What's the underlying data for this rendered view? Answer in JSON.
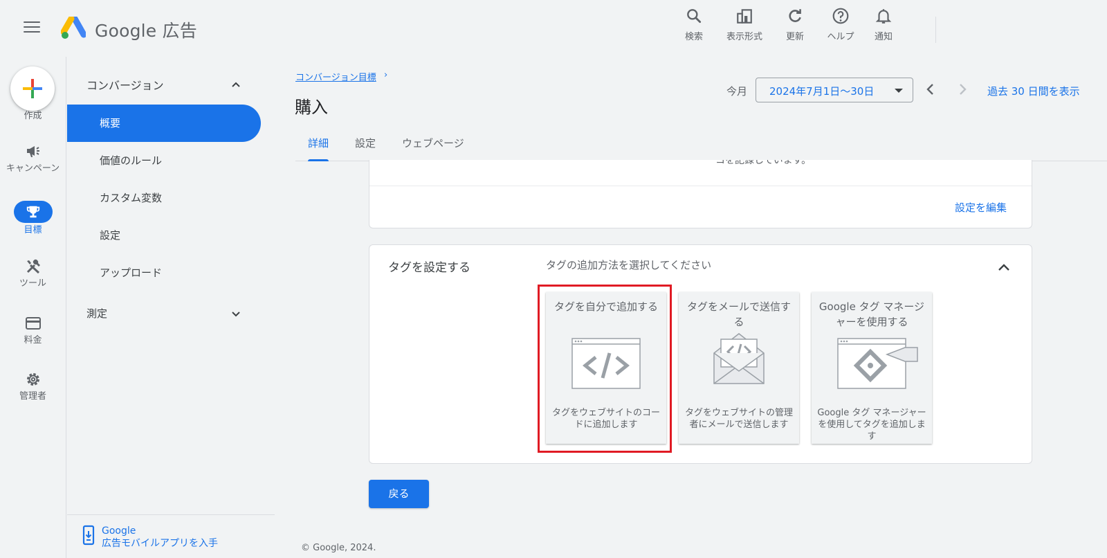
{
  "header": {
    "brand": "Google 広告",
    "tools": [
      {
        "icon": "search-icon",
        "label": "検索"
      },
      {
        "icon": "view-format-icon",
        "label": "表示形式"
      },
      {
        "icon": "refresh-icon",
        "label": "更新"
      },
      {
        "icon": "help-icon",
        "label": "ヘルプ"
      },
      {
        "icon": "bell-icon",
        "label": "通知"
      }
    ]
  },
  "rail": {
    "create_label": "作成",
    "items": [
      {
        "icon": "megaphone-icon",
        "label": "キャンペーン"
      },
      {
        "icon": "trophy-icon",
        "label": "目標",
        "active": true
      },
      {
        "icon": "tools-icon",
        "label": "ツール"
      },
      {
        "icon": "credit-card-icon",
        "label": "料金"
      },
      {
        "icon": "gear-icon",
        "label": "管理者"
      }
    ]
  },
  "subnav": {
    "section1": "コンバージョン",
    "items": [
      "概要",
      "価値のルール",
      "カスタム変数",
      "設定",
      "アップロード"
    ],
    "active_index": 0,
    "section2": "測定",
    "mobile_line1": "Google",
    "mobile_line2": "広告モバイルアプリを入手"
  },
  "page": {
    "breadcrumb": "コンバージョン目標",
    "breadcrumb_chevron": "›",
    "title": "購入",
    "tabs": [
      "詳細",
      "設定",
      "ウェブページ"
    ],
    "active_tab": 0
  },
  "date": {
    "label": "今月",
    "value": "2024年7月1日～30日",
    "last_days": "過去 30 日間を表示"
  },
  "card1": {
    "cut_text": "コを記録しています。",
    "edit_link": "設定を編集"
  },
  "tag_setup": {
    "title": "タグを設定する",
    "subtitle": "タグの追加方法を選択してください",
    "options": [
      {
        "title": "タグを自分で追加する",
        "desc": "タグをウェブサイトのコードに追加します",
        "icon": "code-window-icon",
        "selected": true
      },
      {
        "title": "タグをメールで送信する",
        "desc": "タグをウェブサイトの管理者にメールで送信します",
        "icon": "email-code-icon"
      },
      {
        "title": "Google タグ マネージャーを使用する",
        "desc": "Google タグ マネージャーを使用してタグを追加します",
        "icon": "tag-manager-icon"
      }
    ]
  },
  "back_button": "戻る",
  "footer": "© Google, 2024.",
  "colors": {
    "accent": "#1a73e8",
    "highlight": "#e01b24",
    "background": "#f1f3f4"
  }
}
